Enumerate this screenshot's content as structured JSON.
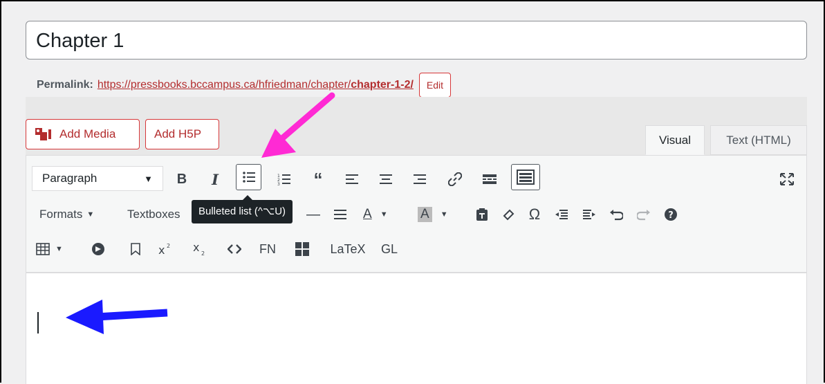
{
  "title_field": {
    "value": "Chapter 1"
  },
  "permalink": {
    "label": "Permalink:",
    "url_prefix": "https://pressbooks.bccampus.ca/hfriedman/chapter/",
    "slug": "chapter-1-2/",
    "edit_label": "Edit"
  },
  "media": {
    "add_media_label": "Add Media",
    "add_h5p_label": "Add H5P"
  },
  "tabs": {
    "visual": "Visual",
    "text": "Text (HTML)"
  },
  "toolbar": {
    "format_select": "Paragraph",
    "bold": "B",
    "italic": "I",
    "formats": "Formats",
    "textboxes": "Textboxes",
    "omega": "Ω",
    "footnote": "FN",
    "latex": "LaTeX",
    "glossary": "GL",
    "tooltip": "Bulleted list (^⌥U)"
  },
  "colors": {
    "accent": "#b32d2e",
    "arrow_pink": "#ff2ad4",
    "arrow_blue": "#1a1aff"
  }
}
